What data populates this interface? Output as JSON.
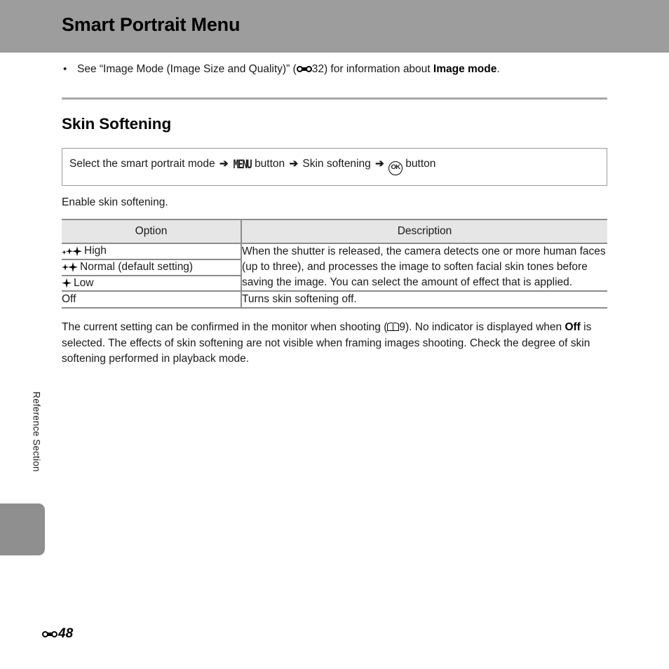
{
  "header": {
    "title": "Smart Portrait Menu"
  },
  "side": {
    "label": "Reference Section"
  },
  "intro_bullet": {
    "bullet": "•",
    "text_before": "See “Image Mode (Image Size and Quality)” (",
    "ref_page": "32",
    "text_middle": ") for information about ",
    "bold_term": "Image mode",
    "text_after": "."
  },
  "section": {
    "title": "Skin Softening"
  },
  "path_box": {
    "step1": "Select the smart portrait mode",
    "arrow": "➔",
    "menu_icon_label": "MENU",
    "step2": "button",
    "step3": "Skin softening",
    "ok_icon_label": "OK",
    "step4": "button"
  },
  "caption": "Enable skin softening.",
  "table": {
    "headers": [
      "Option",
      "Description"
    ],
    "rows": [
      {
        "sparkles": 3,
        "option": "High",
        "description": "When the shutter is released, the camera detects one or more human faces (up to three), and processes the image to soften facial skin tones before saving the image. You can select the amount of effect that is applied."
      },
      {
        "sparkles": 2,
        "option": "Normal (default setting)"
      },
      {
        "sparkles": 1,
        "option": "Low"
      },
      {
        "sparkles": 0,
        "option": "Off",
        "description": "Turns skin softening off."
      }
    ]
  },
  "closing": {
    "part1": "The current setting can be confirmed in the monitor when shooting (",
    "ref_number": "9",
    "part2": "). No indicator is displayed when ",
    "bold_term": "Off",
    "part3": " is selected. The effects of skin softening are not visible when framing images shooting. Check the degree of skin softening performed in playback mode."
  },
  "footer": {
    "page": "48"
  },
  "colors": {
    "header_band": "#9d9d9d",
    "side_tab": "#8f8f8f",
    "rule": "#a8a8a8",
    "table_header_bg": "#e6e6e6",
    "table_border": "#8c8c8c"
  }
}
